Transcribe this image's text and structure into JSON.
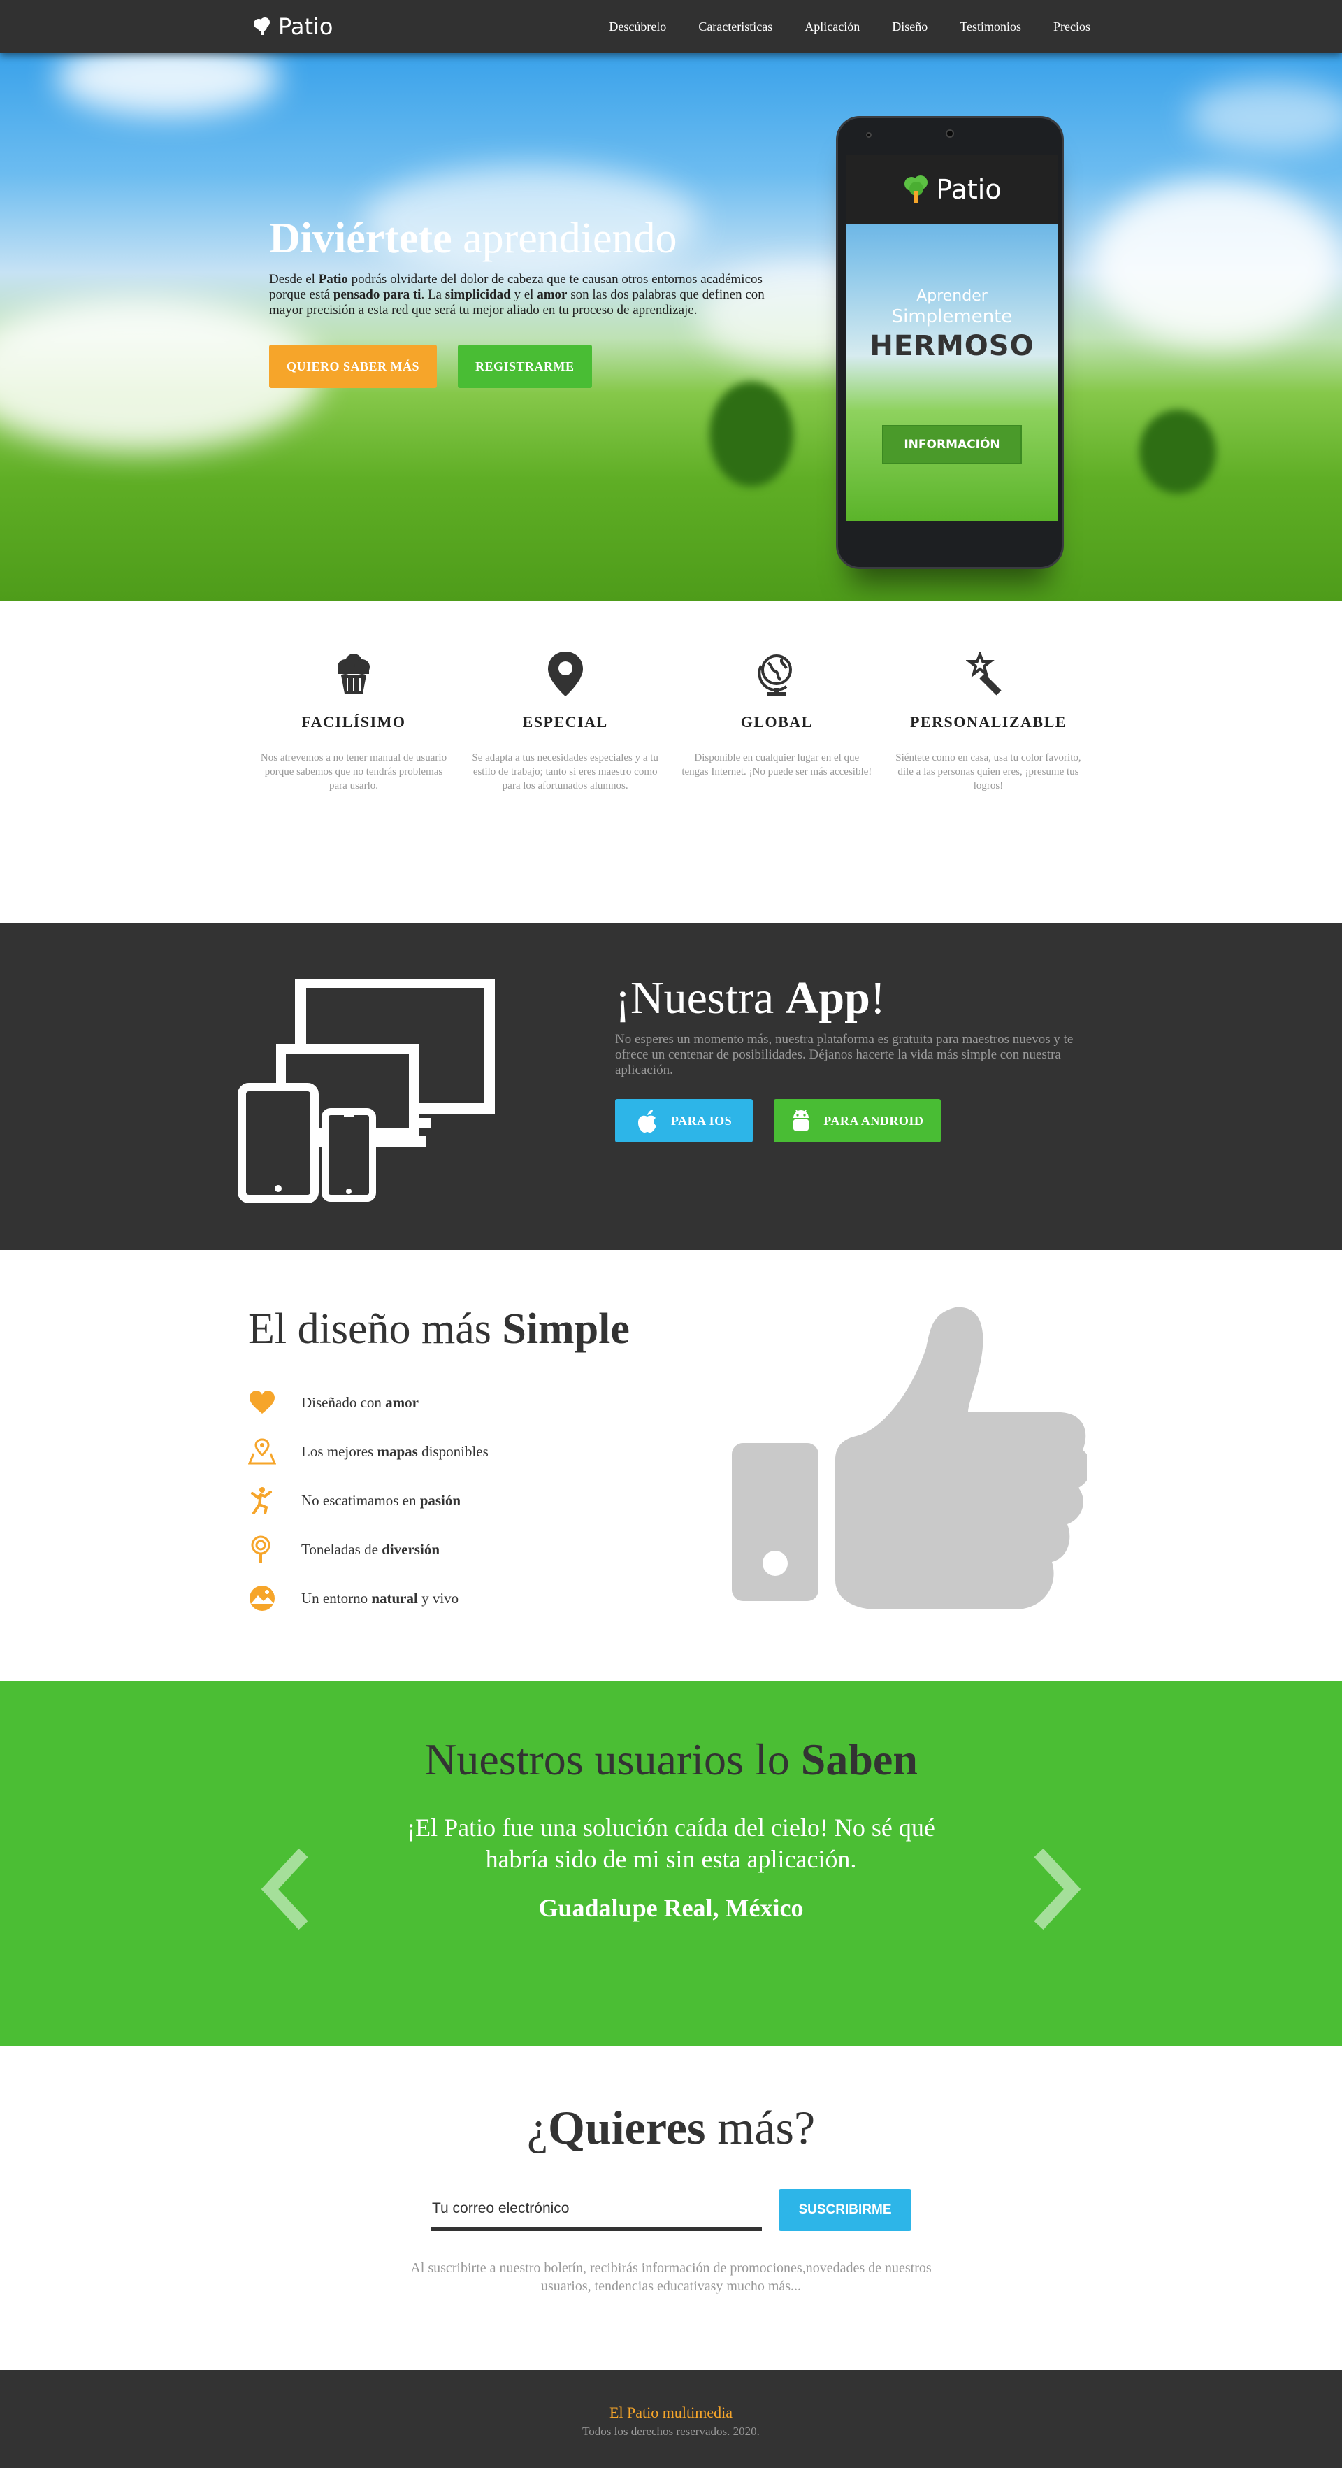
{
  "nav": {
    "brand": "Patio",
    "items": [
      "Descúbrelo",
      "Caracteristicas",
      "Aplicación",
      "Diseño",
      "Testimonios",
      "Precios"
    ]
  },
  "hero": {
    "title_bold": "Diviértete",
    "title_rest": " aprendiendo",
    "desc": {
      "p1": "Desde el ",
      "b1": "Patio",
      "p2": " podrás olvidarte del dolor de cabeza que te causan otros entornos académicos porque está ",
      "b2": "pensado para ti",
      "p3": ". La ",
      "b3": "simplicidad",
      "p4": " y el ",
      "b4": "amor",
      "p5": " son las dos palabras que definen con mayor precisión a esta red que será tu mejor aliado en tu proceso de aprendizaje."
    },
    "btn_more": "QUIERO SABER MÁS",
    "btn_register": "REGISTRARME"
  },
  "phone": {
    "brand": "Patio",
    "line1": "Aprender",
    "line2": "Simplemente",
    "line3": "HERMOSO",
    "btn": "INFORMACIÓN"
  },
  "features": [
    {
      "icon": "cupcake-icon",
      "title": "FACILÍSIMO",
      "text": "Nos atrevemos a no tener manual de usuario porque sabemos que no tendrás problemas para usarlo."
    },
    {
      "icon": "map-pin-icon",
      "title": "ESPECIAL",
      "text": "Se adapta a tus necesidades especiales y a tu estilo de trabajo; tanto si eres maestro como para los afortunados alumnos."
    },
    {
      "icon": "globe-icon",
      "title": "GLOBAL",
      "text": "Disponible en cualquier lugar en el que tengas Internet. ¡No puede ser más accesible!"
    },
    {
      "icon": "magic-wand-icon",
      "title": "PERSONALIZABLE",
      "text": "Siéntete como en casa, usa tu color favorito, dile a las personas quien eres, ¡presume tus logros!"
    }
  ],
  "app": {
    "title_pre": "¡Nuestra ",
    "title_bold": "App",
    "title_post": "!",
    "desc": "No esperes un momento más, nuestra plataforma es gratuita para maestros nuevos y te ofrece un centenar de posibilidades. Déjanos hacerte la vida más simple con nuestra aplicación.",
    "btn_ios": "PARA IOS",
    "btn_android": "PARA ANDROID"
  },
  "design": {
    "title_pre": "El diseño más ",
    "title_bold": "Simple",
    "items": [
      {
        "icon": "heart-icon",
        "pre": "Diseñado con ",
        "bold": "amor",
        "post": ""
      },
      {
        "icon": "map-icon",
        "pre": "Los mejores ",
        "bold": "mapas",
        "post": " disponibles"
      },
      {
        "icon": "runner-icon",
        "pre": "No escatimamos en ",
        "bold": "pasión",
        "post": ""
      },
      {
        "icon": "lollipop-icon",
        "pre": "Toneladas de ",
        "bold": "diversión",
        "post": ""
      },
      {
        "icon": "landscape-icon",
        "pre": "Un entorno ",
        "bold": "natural",
        "post": " y vivo"
      }
    ]
  },
  "testimonials": {
    "title_pre": "Nuestros usuarios lo ",
    "title_bold": "Saben",
    "quote": "¡El Patio fue una solución caída del cielo! No sé qué habría sido de mi sin esta aplicación.",
    "author": "Guadalupe Real, México"
  },
  "newsletter": {
    "title_pre": "¿",
    "title_bold": "Quieres",
    "title_post": " más?",
    "placeholder": "Tu correo electrónico",
    "btn": "SUSCRIBIRME",
    "note": "Al suscribirte a nuestro boletín, recibirás información de promociones,novedades de nuestros usuarios, tendencias educativasy mucho más..."
  },
  "footer": {
    "brand": "El Patio multimedia",
    "copy": "Todos los derechos reservados. 2020."
  },
  "colors": {
    "orange": "#f6a52a",
    "green": "#49bd34",
    "blue": "#2db5e8",
    "dark": "#333333"
  }
}
